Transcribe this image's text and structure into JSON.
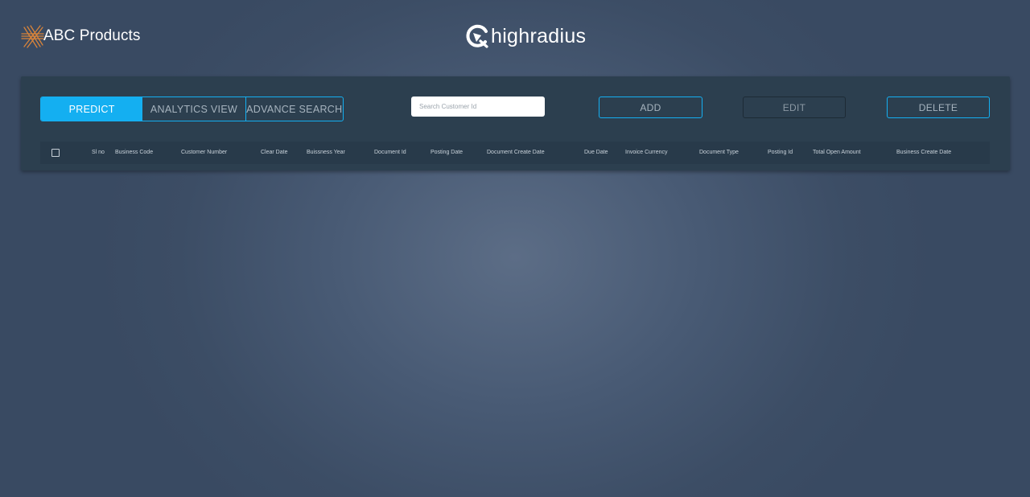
{
  "header": {
    "company_name": "ABC Products",
    "company_logo_icon": "abc-logo-icon",
    "brand_name": "highradius",
    "brand_logo_icon": "highradius-logo-icon"
  },
  "colors": {
    "accent": "#14aff1",
    "panel": "#2c3f4f",
    "table_header": "#283a4a",
    "background": "#4a5b74"
  },
  "toolbar": {
    "tabs": [
      {
        "label": "PREDICT",
        "active": true
      },
      {
        "label": "ANALYTICS VIEW",
        "active": false
      },
      {
        "label": "ADVANCE SEARCH",
        "active": false
      }
    ],
    "search_placeholder": "Search Customer Id",
    "add_label": "ADD",
    "edit_label": "EDIT",
    "delete_label": "DELETE"
  },
  "table": {
    "columns": [
      "Sl no",
      "Business Code",
      "Customer Number",
      "Clear Date",
      "Buissness Year",
      "Document Id",
      "Posting Date",
      "Document Create Date",
      "Due Date",
      "Invoice Currency",
      "Document Type",
      "Posting Id",
      "Total Open Amount",
      "Business Create Date"
    ],
    "rows": []
  }
}
